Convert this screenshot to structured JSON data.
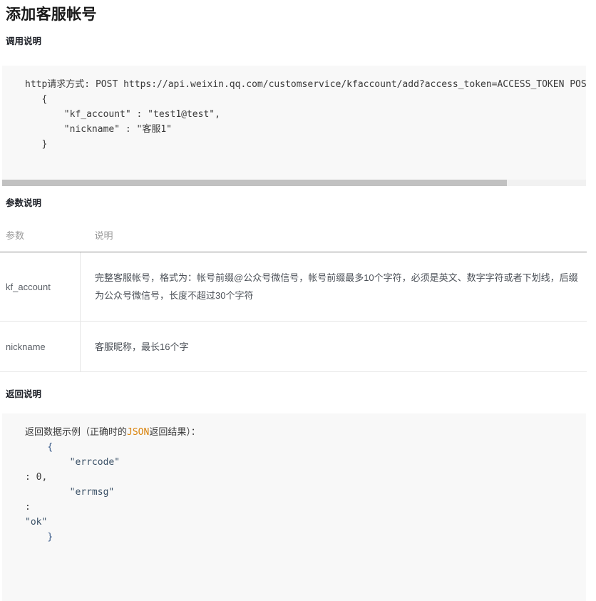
{
  "document": {
    "title": "添加客服帐号"
  },
  "sections": {
    "call": {
      "heading": "调用说明",
      "code_lines": [
        "http请求方式: POST https://api.weixin.qq.com/customservice/kfaccount/add?access_token=ACCESS_TOKEN POST",
        "   {",
        "       \"kf_account\" : \"test1@test\",",
        "       \"nickname\" : \"客服1\"",
        "   }"
      ],
      "scrollbar": {
        "visible": true,
        "thumb_fraction": 0.865
      }
    },
    "params": {
      "heading": "参数说明",
      "columns": [
        "参数",
        "说明"
      ],
      "rows": [
        {
          "name": "kf_account",
          "description": "完整客服帐号，格式为：帐号前缀@公众号微信号，帐号前缀最多10个字符，必须是英文、数字字符或者下划线，后缀为公众号微信号，长度不超过30个字符"
        },
        {
          "name": "nickname",
          "description": "客服昵称，最长16个字"
        }
      ]
    },
    "return": {
      "heading": "返回说明",
      "code_lines": [
        {
          "indent": 0,
          "text": "返回数据示例（正确时的JSON返回结果）：",
          "highlight": "JSON"
        },
        {
          "indent": 1,
          "text": "{"
        },
        {
          "indent": 2,
          "text": "\"errcode\""
        },
        {
          "indent": 0,
          "text": ": 0,"
        },
        {
          "indent": 2,
          "text": "\"errmsg\""
        },
        {
          "indent": 0,
          "text": ":"
        },
        {
          "indent": -1,
          "text": "\"ok\""
        },
        {
          "indent": 1,
          "text": "}"
        }
      ]
    }
  },
  "colors": {
    "code_background": "#f8f8f8",
    "scrollbar_thumb": "#c1c1c1",
    "table_header_text": "#9b9b9b",
    "highlight_token": "#d9820a",
    "punctuation_token": "#3b5c8a"
  }
}
